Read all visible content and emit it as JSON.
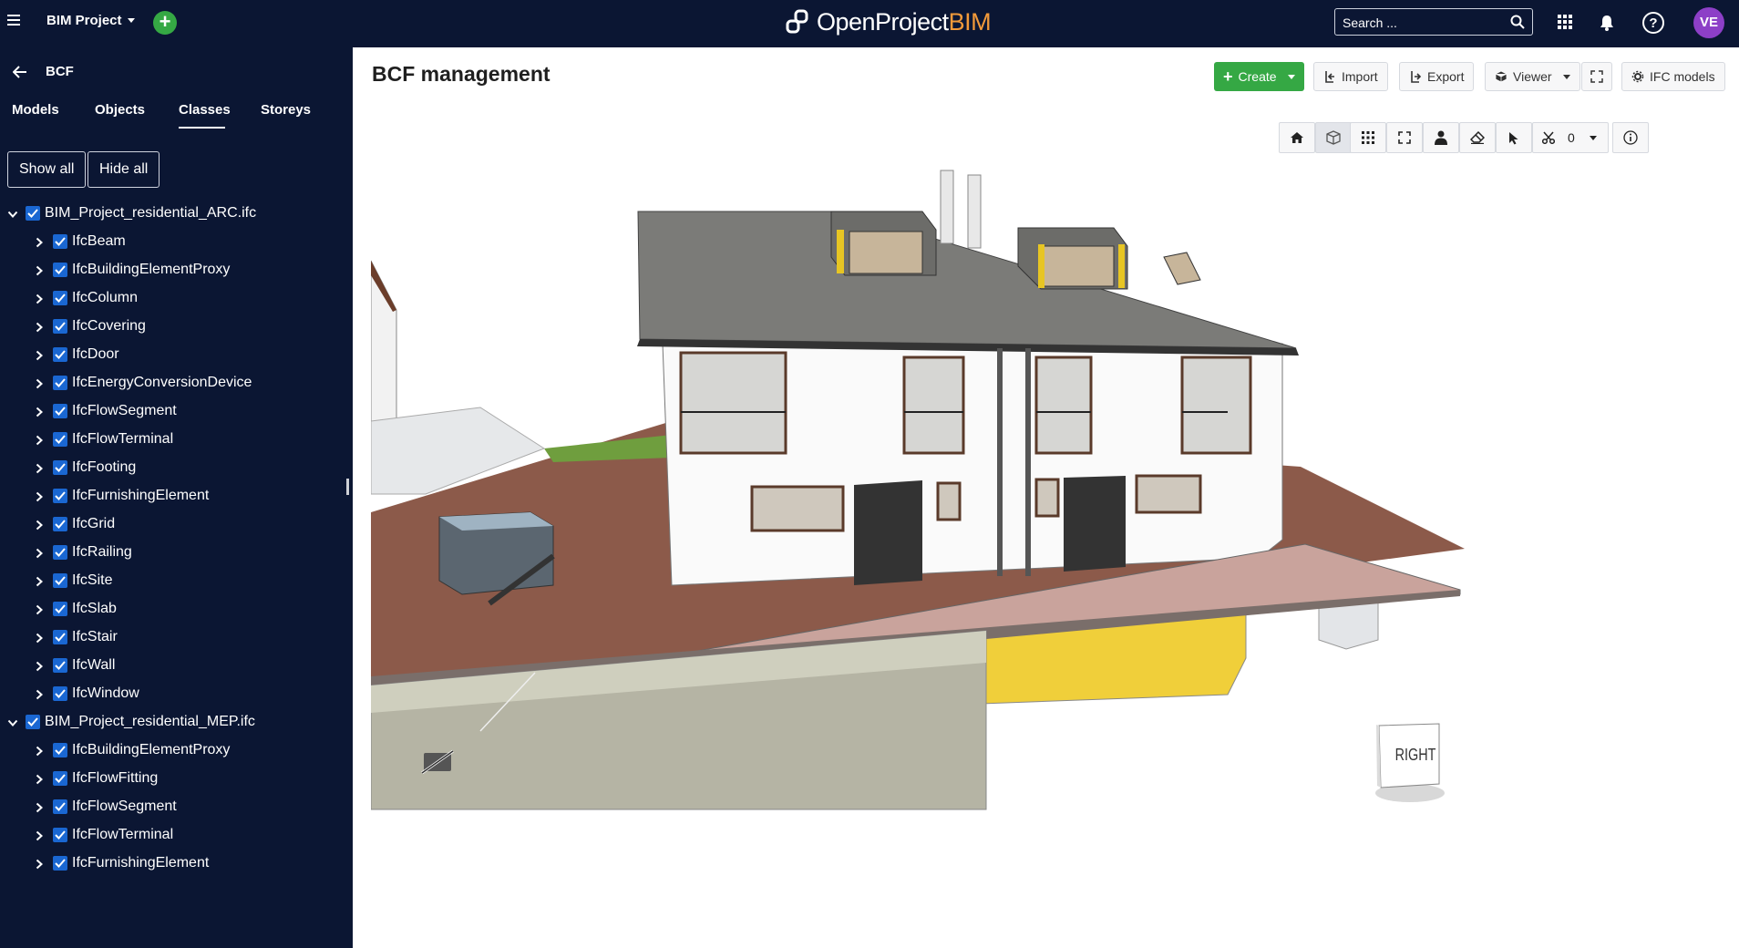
{
  "header": {
    "project_name": "BIM Project",
    "logo_text_main": "OpenProject",
    "logo_text_accent": "BIM",
    "search_placeholder": "Search ...",
    "avatar_initials": "VE"
  },
  "sidebar": {
    "back_title": "BCF",
    "tabs": [
      {
        "label": "Models",
        "active": false
      },
      {
        "label": "Objects",
        "active": false
      },
      {
        "label": "Classes",
        "active": true
      },
      {
        "label": "Storeys",
        "active": false
      }
    ],
    "show_all_label": "Show all",
    "hide_all_label": "Hide all",
    "models": [
      {
        "name": "BIM_Project_residential_ARC.ifc",
        "checked": true,
        "classes": [
          "IfcBeam",
          "IfcBuildingElementProxy",
          "IfcColumn",
          "IfcCovering",
          "IfcDoor",
          "IfcEnergyConversionDevice",
          "IfcFlowSegment",
          "IfcFlowTerminal",
          "IfcFooting",
          "IfcFurnishingElement",
          "IfcGrid",
          "IfcRailing",
          "IfcSite",
          "IfcSlab",
          "IfcStair",
          "IfcWall",
          "IfcWindow"
        ]
      },
      {
        "name": "BIM_Project_residential_MEP.ifc",
        "checked": true,
        "classes": [
          "IfcBuildingElementProxy",
          "IfcFlowFitting",
          "IfcFlowSegment",
          "IfcFlowTerminal",
          "IfcFurnishingElement"
        ]
      }
    ]
  },
  "main": {
    "page_title": "BCF management",
    "toolbar": {
      "create_label": "Create",
      "import_label": "Import",
      "export_label": "Export",
      "viewer_label": "Viewer",
      "ifc_models_label": "IFC models"
    },
    "viewer_toolbar": {
      "section_count": "0"
    },
    "nav_cube_label": "RIGHT"
  },
  "colors": {
    "header_bg": "#0b1633",
    "accent_green": "#35a844",
    "logo_accent": "#f29a3a",
    "checkbox_blue": "#1a67d2",
    "avatar_bg": "#8d3fc7"
  }
}
